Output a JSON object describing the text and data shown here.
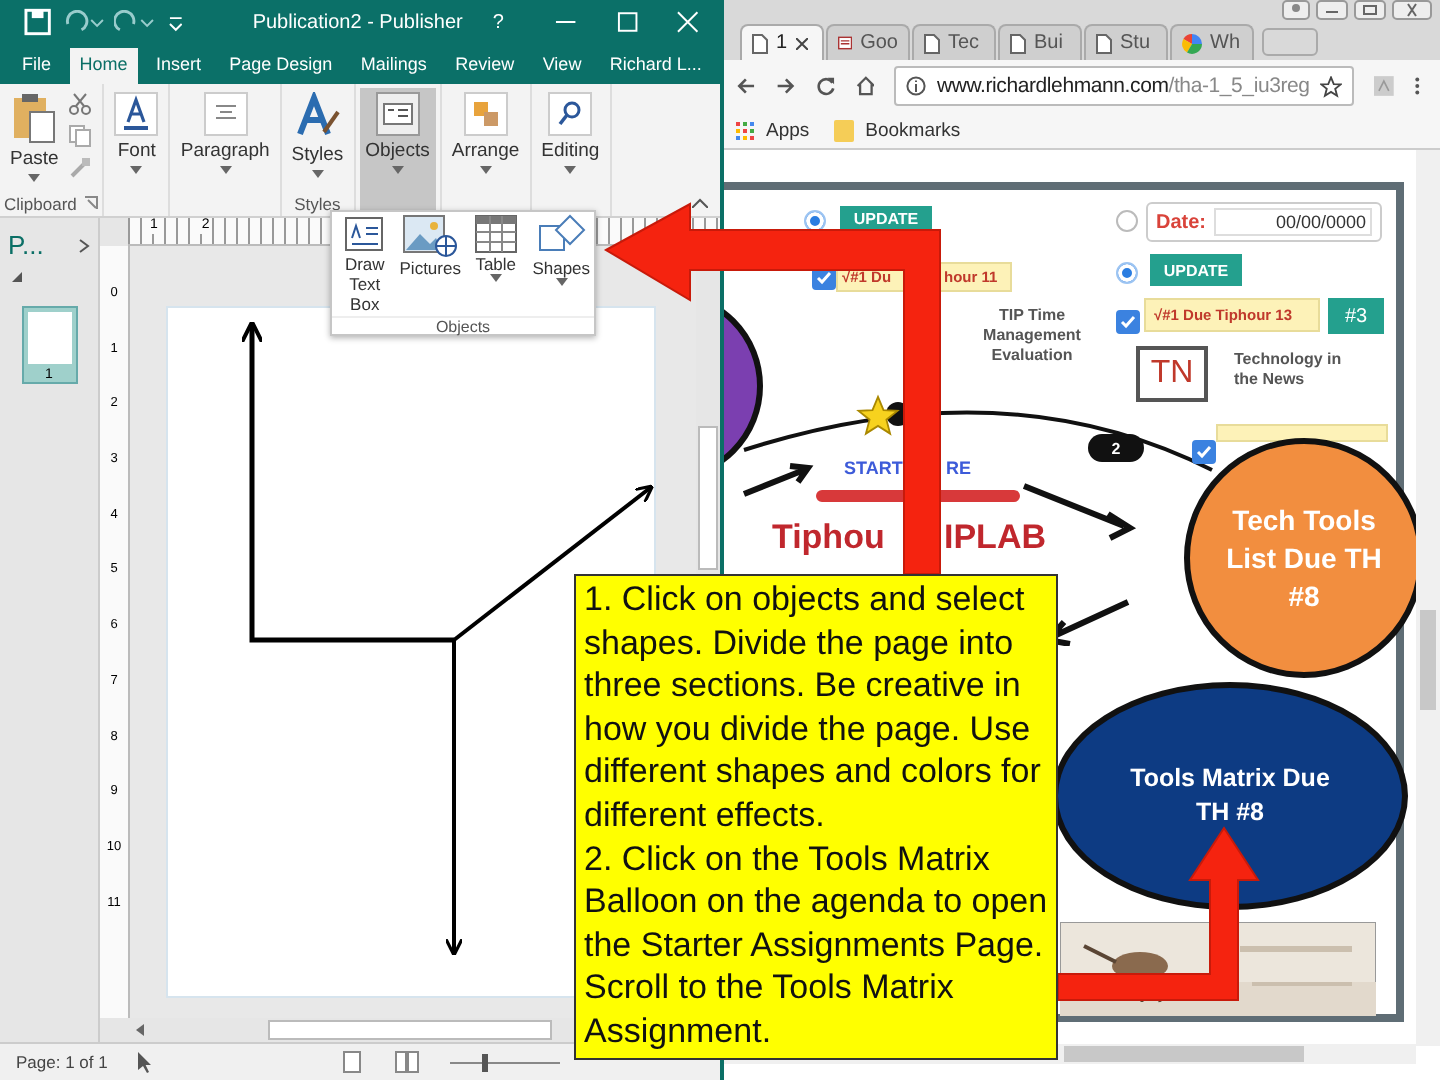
{
  "publisher": {
    "title": "Publication2 - Publisher",
    "help": "?",
    "tabs": [
      {
        "label": "File",
        "selected": false
      },
      {
        "label": "Home",
        "selected": true
      },
      {
        "label": "Insert",
        "selected": false
      },
      {
        "label": "Page Design",
        "selected": false
      },
      {
        "label": "Mailings",
        "selected": false
      },
      {
        "label": "Review",
        "selected": false
      },
      {
        "label": "View",
        "selected": false
      },
      {
        "label": "Richard L...",
        "selected": false
      }
    ],
    "ribbon": [
      {
        "label": "Clipboard",
        "buttons": [
          {
            "label": "Paste",
            "kind": "paste",
            "pressed": false
          }
        ]
      },
      {
        "buttons": [
          {
            "label": "Font",
            "kind": "font",
            "pressed": false
          }
        ]
      },
      {
        "buttons": [
          {
            "label": "Paragraph",
            "kind": "paragraph",
            "pressed": false
          }
        ]
      },
      {
        "label": "Styles",
        "buttons": [
          {
            "label": "Styles",
            "kind": "styles",
            "pressed": false
          }
        ]
      },
      {
        "buttons": [
          {
            "label": "Objects",
            "kind": "objects",
            "pressed": true
          }
        ]
      },
      {
        "buttons": [
          {
            "label": "Arrange",
            "kind": "arrange",
            "pressed": false
          }
        ]
      },
      {
        "buttons": [
          {
            "label": "Editing",
            "kind": "editing",
            "pressed": false
          }
        ]
      }
    ],
    "objects_menu": {
      "label": "Objects",
      "items": [
        {
          "label": "Draw Text Box",
          "kind": "textbox",
          "caret": false
        },
        {
          "label": "Pictures",
          "kind": "pictures",
          "caret": false
        },
        {
          "label": "Table",
          "kind": "table",
          "caret": true
        },
        {
          "label": "Shapes",
          "kind": "shapes",
          "caret": true
        }
      ]
    },
    "pages_pane": {
      "title": "P...",
      "pages": [
        {
          "number": "1",
          "selected": true
        }
      ]
    },
    "ruler": {
      "horizontal": [
        "1",
        "2"
      ],
      "vertical": [
        "0",
        "1",
        "2",
        "3",
        "4",
        "5",
        "6",
        "7",
        "8",
        "9",
        "10",
        "11"
      ]
    },
    "status": "Page: 1 of 1",
    "zoom": {
      "level": 0.3
    }
  },
  "browser": {
    "tabs": [
      {
        "label": "1",
        "kind": "page",
        "selected": true
      },
      {
        "label": "Goo",
        "kind": "doc",
        "selected": false
      },
      {
        "label": "Tec",
        "kind": "page",
        "selected": false
      },
      {
        "label": "Bui",
        "kind": "page",
        "selected": false
      },
      {
        "label": "Stu",
        "kind": "page",
        "selected": false
      },
      {
        "label": "Wh",
        "kind": "google",
        "selected": false
      }
    ],
    "url_host": "www.richardlehmann.com",
    "url_path": "/tha-1_5_iu3reg",
    "bookmarks": [
      "Apps",
      "Bookmarks"
    ]
  },
  "webpage": {
    "radios": [
      {
        "selected": true
      },
      {
        "selected": false
      },
      {
        "selected": true
      }
    ],
    "checkboxes": [
      {
        "checked": true
      },
      {
        "checked": true
      },
      {
        "checked": true
      }
    ],
    "left_update": "UPDATE",
    "left_due": [
      "√#1 Du",
      "hour 11"
    ],
    "tip_eval": "TIP Time Management Evaluation",
    "date_label": "Date:",
    "date_value": "00/00/0000",
    "right_update": "UPDATE",
    "right_due": "√#1 Due Tiphour 13",
    "badge": "#3",
    "tn_logo": "TN",
    "tech_news": "Technology in the News",
    "start": [
      "START",
      "RE"
    ],
    "logo": [
      "Tiphou",
      "IPLAB"
    ],
    "step": "2",
    "tech_tools": "Tech Tools List Due TH #8",
    "tools_matrix": "Tools Matrix Due TH #8"
  },
  "callout": {
    "paragraphs": [
      "1. Click on objects and select shapes. Divide the page into three sections. Be creative in how you divide the page. Use different shapes and colors for different effects.",
      "2. Click on the Tools Matrix Balloon on the agenda to open the Starter Assignments Page. Scroll to the Tools Matrix Assignment."
    ]
  }
}
